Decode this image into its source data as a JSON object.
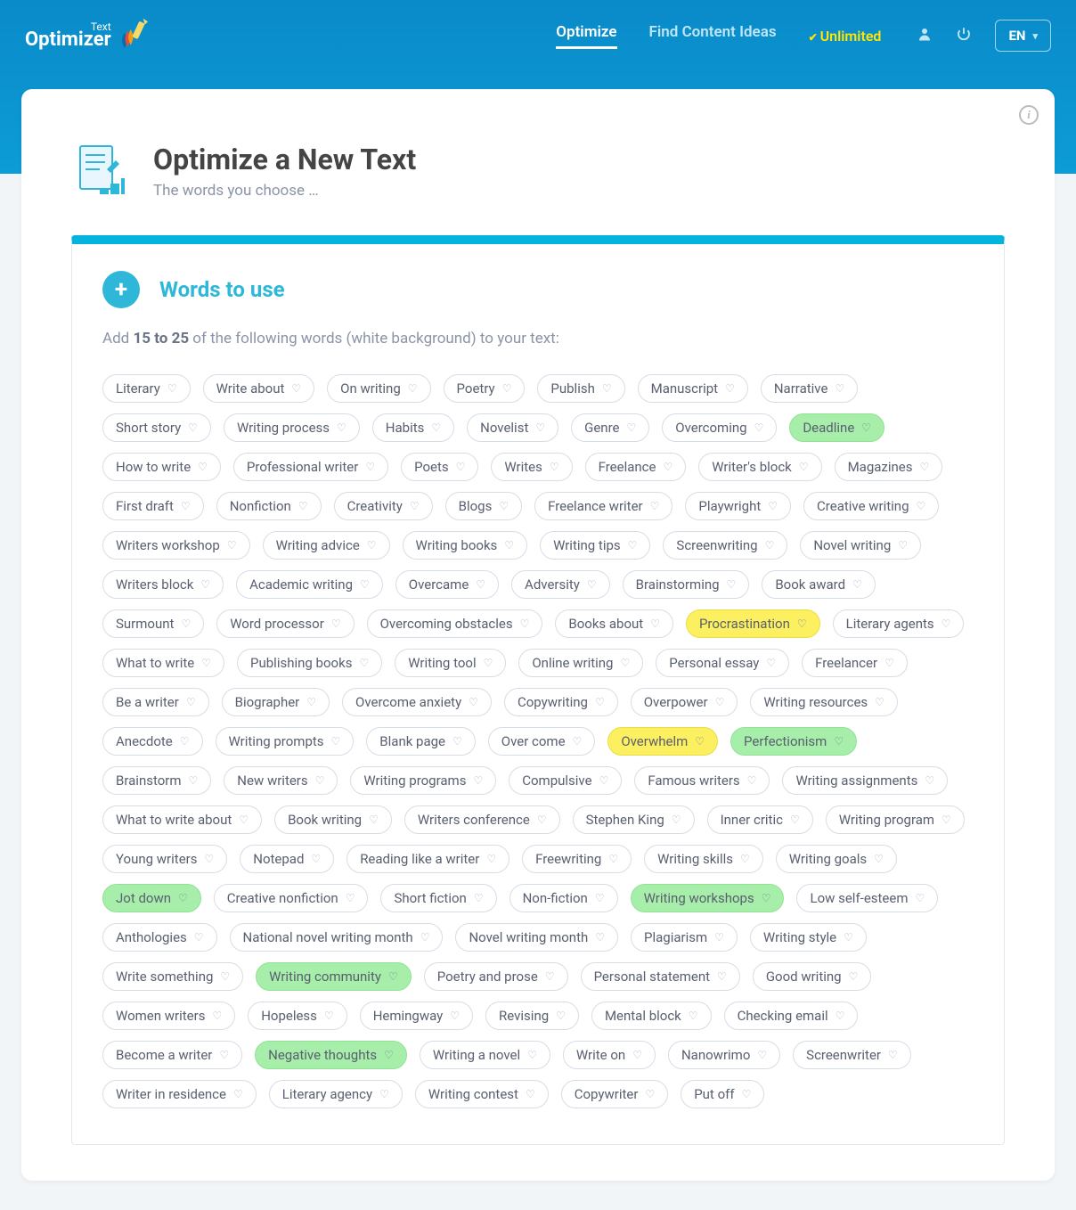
{
  "nav": {
    "logo_top": "Text",
    "logo_bottom": "Optimizer",
    "links": {
      "optimize": "Optimize",
      "find_ideas": "Find Content Ideas",
      "unlimited": "Unlimited"
    },
    "lang": "EN"
  },
  "page": {
    "title": "Optimize a New Text",
    "subtitle": "The words you choose …"
  },
  "panel": {
    "title": "Words to use",
    "desc_prefix": "Add ",
    "desc_bold": "15 to 25",
    "desc_suffix": " of the following words (white background) to your text:"
  },
  "pills": [
    {
      "t": "Literary",
      "s": ""
    },
    {
      "t": "Write about",
      "s": ""
    },
    {
      "t": "On writing",
      "s": ""
    },
    {
      "t": "Poetry",
      "s": ""
    },
    {
      "t": "Publish",
      "s": ""
    },
    {
      "t": "Manuscript",
      "s": ""
    },
    {
      "t": "Narrative",
      "s": ""
    },
    {
      "t": "Short story",
      "s": ""
    },
    {
      "t": "Writing process",
      "s": ""
    },
    {
      "t": "Habits",
      "s": ""
    },
    {
      "t": "Novelist",
      "s": ""
    },
    {
      "t": "Genre",
      "s": ""
    },
    {
      "t": "Overcoming",
      "s": ""
    },
    {
      "t": "Deadline",
      "s": "green"
    },
    {
      "t": "How to write",
      "s": ""
    },
    {
      "t": "Professional writer",
      "s": ""
    },
    {
      "t": "Poets",
      "s": ""
    },
    {
      "t": "Writes",
      "s": ""
    },
    {
      "t": "Freelance",
      "s": ""
    },
    {
      "t": "Writer's block",
      "s": ""
    },
    {
      "t": "Magazines",
      "s": ""
    },
    {
      "t": "First draft",
      "s": ""
    },
    {
      "t": "Nonfiction",
      "s": ""
    },
    {
      "t": "Creativity",
      "s": ""
    },
    {
      "t": "Blogs",
      "s": ""
    },
    {
      "t": "Freelance writer",
      "s": ""
    },
    {
      "t": "Playwright",
      "s": ""
    },
    {
      "t": "Creative writing",
      "s": ""
    },
    {
      "t": "Writers workshop",
      "s": ""
    },
    {
      "t": "Writing advice",
      "s": ""
    },
    {
      "t": "Writing books",
      "s": ""
    },
    {
      "t": "Writing tips",
      "s": ""
    },
    {
      "t": "Screenwriting",
      "s": ""
    },
    {
      "t": "Novel writing",
      "s": ""
    },
    {
      "t": "Writers block",
      "s": ""
    },
    {
      "t": "Academic writing",
      "s": ""
    },
    {
      "t": "Overcame",
      "s": ""
    },
    {
      "t": "Adversity",
      "s": ""
    },
    {
      "t": "Brainstorming",
      "s": ""
    },
    {
      "t": "Book award",
      "s": ""
    },
    {
      "t": "Surmount",
      "s": ""
    },
    {
      "t": "Word processor",
      "s": ""
    },
    {
      "t": "Overcoming obstacles",
      "s": ""
    },
    {
      "t": "Books about",
      "s": ""
    },
    {
      "t": "Procrastination",
      "s": "yellow"
    },
    {
      "t": "Literary agents",
      "s": ""
    },
    {
      "t": "What to write",
      "s": ""
    },
    {
      "t": "Publishing books",
      "s": ""
    },
    {
      "t": "Writing tool",
      "s": ""
    },
    {
      "t": "Online writing",
      "s": ""
    },
    {
      "t": "Personal essay",
      "s": ""
    },
    {
      "t": "Freelancer",
      "s": ""
    },
    {
      "t": "Be a writer",
      "s": ""
    },
    {
      "t": "Biographer",
      "s": ""
    },
    {
      "t": "Overcome anxiety",
      "s": ""
    },
    {
      "t": "Copywriting",
      "s": ""
    },
    {
      "t": "Overpower",
      "s": ""
    },
    {
      "t": "Writing resources",
      "s": ""
    },
    {
      "t": "Anecdote",
      "s": ""
    },
    {
      "t": "Writing prompts",
      "s": ""
    },
    {
      "t": "Blank page",
      "s": ""
    },
    {
      "t": "Over come",
      "s": ""
    },
    {
      "t": "Overwhelm",
      "s": "yellow"
    },
    {
      "t": "Perfectionism",
      "s": "green"
    },
    {
      "t": "Brainstorm",
      "s": ""
    },
    {
      "t": "New writers",
      "s": ""
    },
    {
      "t": "Writing programs",
      "s": ""
    },
    {
      "t": "Compulsive",
      "s": ""
    },
    {
      "t": "Famous writers",
      "s": ""
    },
    {
      "t": "Writing assignments",
      "s": ""
    },
    {
      "t": "What to write about",
      "s": ""
    },
    {
      "t": "Book writing",
      "s": ""
    },
    {
      "t": "Writers conference",
      "s": ""
    },
    {
      "t": "Stephen King",
      "s": ""
    },
    {
      "t": "Inner critic",
      "s": ""
    },
    {
      "t": "Writing program",
      "s": ""
    },
    {
      "t": "Young writers",
      "s": ""
    },
    {
      "t": "Notepad",
      "s": ""
    },
    {
      "t": "Reading like a writer",
      "s": ""
    },
    {
      "t": "Freewriting",
      "s": ""
    },
    {
      "t": "Writing skills",
      "s": ""
    },
    {
      "t": "Writing goals",
      "s": ""
    },
    {
      "t": "Jot down",
      "s": "green"
    },
    {
      "t": "Creative nonfiction",
      "s": ""
    },
    {
      "t": "Short fiction",
      "s": ""
    },
    {
      "t": "Non-fiction",
      "s": ""
    },
    {
      "t": "Writing workshops",
      "s": "green"
    },
    {
      "t": "Low self-esteem",
      "s": ""
    },
    {
      "t": "Anthologies",
      "s": ""
    },
    {
      "t": "National novel writing month",
      "s": ""
    },
    {
      "t": "Novel writing month",
      "s": ""
    },
    {
      "t": "Plagiarism",
      "s": ""
    },
    {
      "t": "Writing style",
      "s": ""
    },
    {
      "t": "Write something",
      "s": ""
    },
    {
      "t": "Writing community",
      "s": "green"
    },
    {
      "t": "Poetry and prose",
      "s": ""
    },
    {
      "t": "Personal statement",
      "s": ""
    },
    {
      "t": "Good writing",
      "s": ""
    },
    {
      "t": "Women writers",
      "s": ""
    },
    {
      "t": "Hopeless",
      "s": ""
    },
    {
      "t": "Hemingway",
      "s": ""
    },
    {
      "t": "Revising",
      "s": ""
    },
    {
      "t": "Mental block",
      "s": ""
    },
    {
      "t": "Checking email",
      "s": ""
    },
    {
      "t": "Become a writer",
      "s": ""
    },
    {
      "t": "Negative thoughts",
      "s": "green"
    },
    {
      "t": "Writing a novel",
      "s": ""
    },
    {
      "t": "Write on",
      "s": ""
    },
    {
      "t": "Nanowrimo",
      "s": ""
    },
    {
      "t": "Screenwriter",
      "s": ""
    },
    {
      "t": "Writer in residence",
      "s": ""
    },
    {
      "t": "Literary agency",
      "s": ""
    },
    {
      "t": "Writing contest",
      "s": ""
    },
    {
      "t": "Copywriter",
      "s": ""
    },
    {
      "t": "Put off",
      "s": ""
    }
  ]
}
